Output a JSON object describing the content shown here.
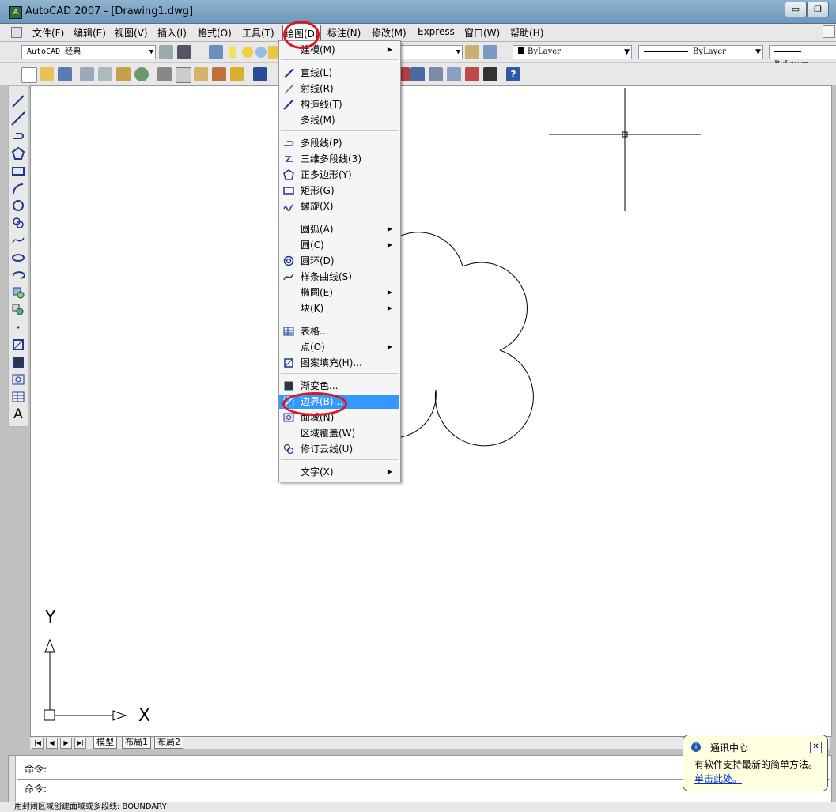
{
  "window": {
    "title": "AutoCAD 2007 - [Drawing1.dwg]",
    "icon": "autocad-app-icon",
    "minimize_label": "▭",
    "restore_label": "❐",
    "close_label": "✕"
  },
  "menubar": {
    "items": [
      {
        "label": "文件(F)"
      },
      {
        "label": "编辑(E)"
      },
      {
        "label": "视图(V)"
      },
      {
        "label": "插入(I)"
      },
      {
        "label": "格式(O)"
      },
      {
        "label": "工具(T)"
      },
      {
        "label": "绘图(D)"
      },
      {
        "label": "标注(N)"
      },
      {
        "label": "修改(M)"
      },
      {
        "label": "Express"
      },
      {
        "label": "窗口(W)"
      },
      {
        "label": "帮助(H)"
      }
    ]
  },
  "toolbar": {
    "workspace": "AutoCAD 经典",
    "color": "ByLayer",
    "linetype": "ByLayer",
    "lineweight": "ByLayer"
  },
  "draw_menu": {
    "items": [
      {
        "label": "建模(M)",
        "submenu": true,
        "icon": ""
      },
      {
        "label": "直线(L)",
        "icon": "line-icon"
      },
      {
        "label": "射线(R)",
        "icon": "ray-icon"
      },
      {
        "label": "构造线(T)",
        "icon": "xline-icon"
      },
      {
        "label": "多线(M)",
        "icon": ""
      },
      {
        "label": "多段线(P)",
        "icon": "polyline-icon"
      },
      {
        "label": "三维多段线(3)",
        "icon": "3dpoly-icon"
      },
      {
        "label": "正多边形(Y)",
        "icon": "polygon-icon"
      },
      {
        "label": "矩形(G)",
        "icon": "rectangle-icon"
      },
      {
        "label": "螺旋(X)",
        "icon": "helix-icon"
      },
      {
        "label": "圆弧(A)",
        "submenu": true,
        "icon": ""
      },
      {
        "label": "圆(C)",
        "submenu": true,
        "icon": ""
      },
      {
        "label": "圆环(D)",
        "icon": "donut-icon"
      },
      {
        "label": "样条曲线(S)",
        "icon": "spline-icon"
      },
      {
        "label": "椭圆(E)",
        "submenu": true,
        "icon": ""
      },
      {
        "label": "块(K)",
        "submenu": true,
        "icon": ""
      },
      {
        "label": "表格...",
        "icon": "table-icon"
      },
      {
        "label": "点(O)",
        "submenu": true,
        "icon": ""
      },
      {
        "label": "图案填充(H)...",
        "icon": "hatch-icon"
      },
      {
        "label": "渐变色...",
        "icon": "gradient-icon"
      },
      {
        "label": "边界(B)...",
        "icon": "boundary-icon",
        "highlighted": true
      },
      {
        "label": "面域(N)",
        "icon": "region-icon"
      },
      {
        "label": "区域覆盖(W)",
        "icon": ""
      },
      {
        "label": "修订云线(U)",
        "icon": "revcloud-icon"
      },
      {
        "label": "文字(X)",
        "submenu": true,
        "icon": ""
      }
    ],
    "submenu_glyph": "▶"
  },
  "tabs": {
    "nav": [
      "|◀",
      "◀",
      "▶",
      "▶|"
    ],
    "items": [
      "模型",
      "布局1",
      "布局2"
    ]
  },
  "command": {
    "line1": "命令:",
    "line2": "命令:",
    "status": "用封闭区域创建面域或多段线:  BOUNDARY"
  },
  "balloon": {
    "title": "通讯中心",
    "message": "有软件支持最新的简单方法。",
    "link": "单击此处。",
    "close_label": "✕"
  },
  "ucs": {
    "x_label": "X",
    "y_label": "Y"
  },
  "colors": {
    "highlight": "#3399ff",
    "annotation_ring": "#e0141e"
  }
}
